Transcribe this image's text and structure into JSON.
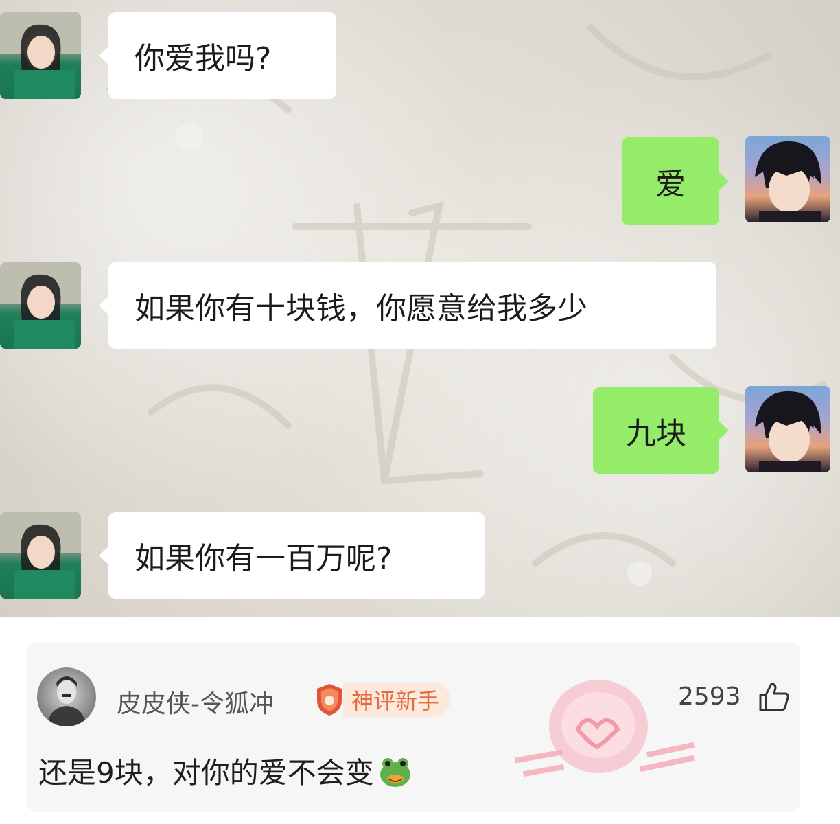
{
  "chat": {
    "messages": [
      {
        "side": "left",
        "text": "你爱我吗?"
      },
      {
        "side": "right",
        "text": "爱"
      },
      {
        "side": "left",
        "text": "如果你有十块钱，你愿意给我多少"
      },
      {
        "side": "right",
        "text": "九块"
      },
      {
        "side": "left",
        "text": "如果你有一百万呢?"
      }
    ],
    "bubble_colors": {
      "left": "#ffffff",
      "right": "#95ec69"
    }
  },
  "comment": {
    "username": "皮皮侠-令狐冲",
    "badge": "神评新手",
    "likes": "2593",
    "text": "还是9块，对你的爱不会变",
    "emoji": "frog-emoji",
    "like_icon": "thumbs-up-icon",
    "badge_color": "#e36a3d"
  }
}
